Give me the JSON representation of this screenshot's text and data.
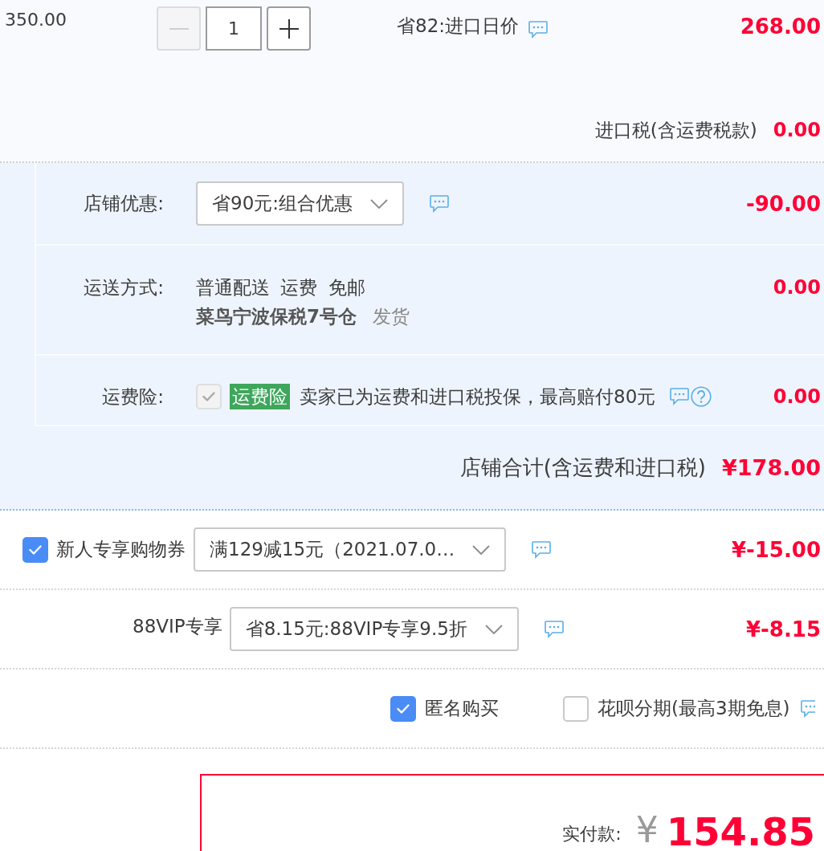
{
  "item": {
    "unit_price": "350.00",
    "quantity": {
      "value": "1",
      "minus_disabled": true
    },
    "promo": "省82:进口日价",
    "subtotal": "268.00",
    "tax_label": "进口税(含运费税款)",
    "tax_amount": "0.00"
  },
  "store": {
    "discount": {
      "label": "店铺优惠:",
      "value": "省90元:组合优惠",
      "amount": "-90.00"
    },
    "shipping": {
      "label": "运送方式:",
      "method": "普通配送 运费 免邮",
      "warehouse": "菜鸟宁波保税7号仓",
      "dispatch": "发货",
      "amount": "0.00"
    },
    "insurance": {
      "label": "运费险:",
      "checked": true,
      "disabled": true,
      "tag": "运费险",
      "text": "卖家已为运费和进口税投保，最高赔付80元",
      "amount": "0.00"
    },
    "total_label": "店铺合计(含运费和进口税)",
    "total": "¥178.00"
  },
  "coupons": [
    {
      "kind": "checkbox",
      "checked": true,
      "label": "新人专享购物券",
      "value": "满129减15元（2021.07.0…",
      "amount": "¥-15.00"
    },
    {
      "kind": "label",
      "label": "88VIP专享",
      "value": "省8.15元:88VIP专享9.5折",
      "amount": "¥-8.15"
    }
  ],
  "options": [
    {
      "label": "匿名购买",
      "checked": true,
      "info": false
    },
    {
      "label": "花呗分期(最高3期免息)",
      "checked": false,
      "info": true
    }
  ],
  "payment": {
    "label": "实付款:",
    "currency": "¥",
    "amount": "154.85"
  }
}
